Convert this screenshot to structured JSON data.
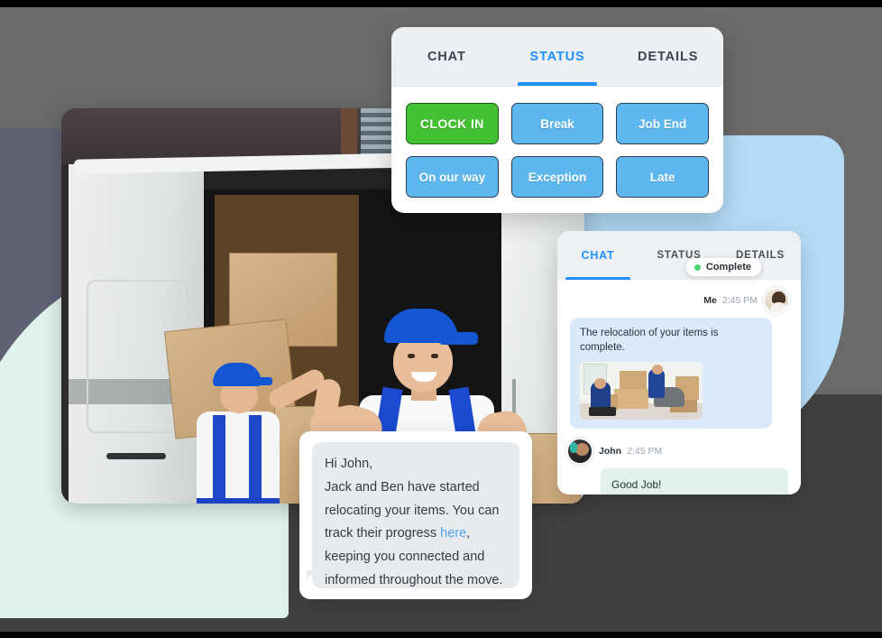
{
  "background": {
    "accent_blue": "#b4dbf8",
    "accent_mint": "#e0f2ec",
    "accent_slate": "#5f6275",
    "grey_upper": "#6a6a6a",
    "grey_lower": "#414141"
  },
  "status_card": {
    "tabs": [
      {
        "label": "CHAT",
        "active": false
      },
      {
        "label": "STATUS",
        "active": true
      },
      {
        "label": "DETAILS",
        "active": false
      }
    ],
    "buttons": [
      {
        "label": "CLOCK IN",
        "style": "green",
        "color": "#44c133"
      },
      {
        "label": "Break",
        "style": "blue",
        "color": "#5cb8ef"
      },
      {
        "label": "Job End",
        "style": "blue",
        "color": "#5cb8ef"
      },
      {
        "label": "On our way",
        "style": "blue",
        "color": "#5cb8ef"
      },
      {
        "label": "Exception",
        "style": "blue",
        "color": "#5cb8ef"
      },
      {
        "label": "Late",
        "style": "blue",
        "color": "#5cb8ef"
      }
    ]
  },
  "chat_card": {
    "tabs": [
      {
        "label": "CHAT",
        "active": true
      },
      {
        "label": "STATUS",
        "active": false
      },
      {
        "label": "DETAILS",
        "active": false
      }
    ],
    "messages": [
      {
        "sender": "Me",
        "time": "2:45 PM",
        "badge": "Complete",
        "badge_color": "#4ad66a",
        "text": "The relocation of your items is complete.",
        "attachment": "movers-photo-thumbnail",
        "avatar": "avatar-me"
      },
      {
        "sender": "John",
        "time": "2:45 PM",
        "text": "Good Job!",
        "avatar": "avatar-john"
      }
    ]
  },
  "note_card": {
    "greeting": "Hi John,",
    "line1": "Jack and Ben have started",
    "line2": "relocating your items. You can",
    "line3_prefix": "track their progress ",
    "link": "here",
    "line3_suffix": ",",
    "line4": "keeping you connected and",
    "line5": "informed throughout the move."
  },
  "hero_photo": {
    "alt": "two movers in blue overalls unloading cardboard boxes from a white van, front worker giving a thumbs up"
  }
}
